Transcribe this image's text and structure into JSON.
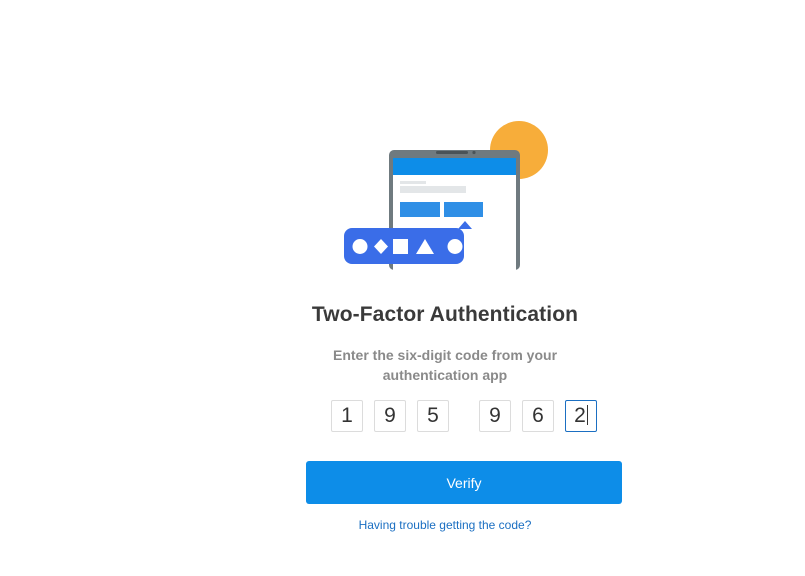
{
  "header": {
    "title": "Two-Factor Authentication",
    "subtitle": "Enter the six-digit code from your authentication app"
  },
  "code": {
    "digits": [
      "1",
      "9",
      "5",
      "9",
      "6",
      "2"
    ],
    "active_index": 5
  },
  "actions": {
    "verify_label": "Verify",
    "help_link": "Having trouble getting the code?"
  },
  "colors": {
    "primary": "#0d8de8",
    "link": "#1b6fc2",
    "illustration_blue": "#3a6de8",
    "illustration_orange": "#f7ad3a",
    "device_frame": "#6f7a7f"
  },
  "icons": [
    "device-illustration",
    "sun-circle-icon",
    "shapes-bubble-icon"
  ]
}
